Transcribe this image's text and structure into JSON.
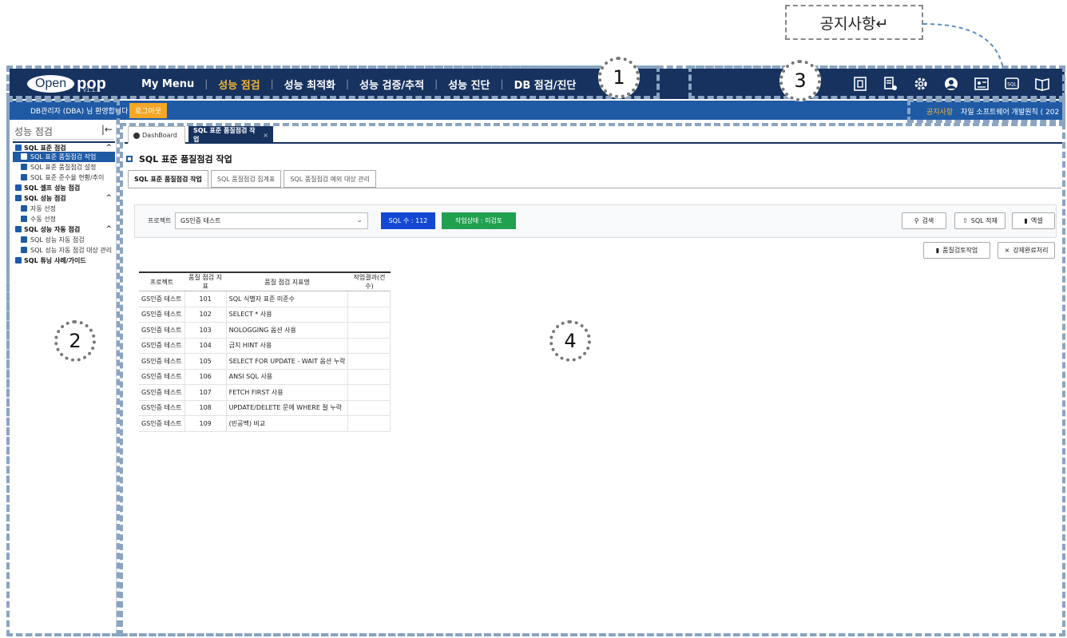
{
  "notice_annotation": "공지사항↵",
  "logo": {
    "left": "Open",
    "right": "pop",
    "version": "v1.1.1"
  },
  "main_nav": [
    {
      "label": "My Menu",
      "active": false
    },
    {
      "label": "성능 점검",
      "active": true
    },
    {
      "label": "성능 최적화",
      "active": false
    },
    {
      "label": "성능 검증/추적",
      "active": false
    },
    {
      "label": "성능 진단",
      "active": false
    },
    {
      "label": "DB 점검/진단",
      "active": false
    }
  ],
  "top_icons": [
    "report-icon",
    "document-settings-icon",
    "settings-gear-icon",
    "user-profile-icon",
    "id-card-icon",
    "sql-book-icon",
    "manual-book-icon"
  ],
  "subbar": {
    "welcome": "DB관리자 (DBA) 님 환영합니다",
    "logout": "로그아웃",
    "notice_label": "공지사항",
    "notice_text": "자일 소프트웨어 개발원칙 ( 202"
  },
  "sidebar": {
    "title": "성능 점검",
    "collapse_icon": "collapse-left-icon",
    "items": [
      {
        "label": "SQL 표준 점검",
        "level": 1,
        "expanded": true,
        "icon": "export-icon",
        "icon_color": "#1f5aa5"
      },
      {
        "label": "SQL 표준 품질점검 작업",
        "level": 2,
        "selected": true,
        "icon": "check-icon",
        "icon_color": "#1f5aa5"
      },
      {
        "label": "SQL 표준 품질점검 설정",
        "level": 2,
        "icon": "check-icon",
        "icon_color": "#1f5aa5"
      },
      {
        "label": "SQL 표준 준수율 현황/추이",
        "level": 2,
        "icon": "brush-icon",
        "icon_color": "#1f5aa5"
      },
      {
        "label": "SQL 셀프 성능 점검",
        "level": 1,
        "icon": "database-icon",
        "icon_color": "#1f5aa5"
      },
      {
        "label": "SQL 성능 점검",
        "level": 1,
        "expanded": true,
        "icon": "wand-icon",
        "icon_color": "#1f5aa5"
      },
      {
        "label": "자동 선정",
        "level": 2,
        "icon": "auto-icon",
        "icon_color": "#1f5aa5"
      },
      {
        "label": "수동 선정",
        "level": 2,
        "icon": "manual-icon",
        "icon_color": "#1f5aa5"
      },
      {
        "label": "SQL 성능 자동 점검",
        "level": 1,
        "expanded": true,
        "icon": "bug-icon",
        "icon_color": "#1f5aa5"
      },
      {
        "label": "SQL 성능 자동 점검",
        "level": 2,
        "icon": "bar-icon",
        "icon_color": "#1f5aa5"
      },
      {
        "label": "SQL 성능 자동 점검 대상 관리",
        "level": 2,
        "icon": "bar-icon",
        "icon_color": "#1f5aa5"
      },
      {
        "label": "SQL 튜닝 사례/가이드",
        "level": 1,
        "icon": "book-icon",
        "icon_color": "#1f5aa5"
      }
    ]
  },
  "content_tabs": [
    {
      "label": "DashBoard",
      "icon": "dashboard-icon"
    },
    {
      "label": "SQL 표준 품질점검 작업",
      "active": true,
      "close": "×"
    }
  ],
  "page_title": "SQL 표준 품질점검 작업",
  "sub_tabs": [
    {
      "label": "SQL 표준 품질점검 작업",
      "active": true
    },
    {
      "label": "SQL 품질점검 집계표"
    },
    {
      "label": "SQL 품질점검 예외 대상 관리"
    }
  ],
  "filter": {
    "project_label": "프로젝트",
    "project_value": "GS인증 테스트",
    "sql_count": "SQL 수 : 112",
    "status": "작업상태 : 미검토"
  },
  "buttons": {
    "search": "검색",
    "sql_load": "SQL 적재",
    "excel": "엑셀",
    "review": "품질검토작업",
    "force_complete": "강제완료처리"
  },
  "table": {
    "headers": [
      "프로젝트",
      "품질 점검 지표",
      "품질 점검 지표명",
      "작업결과(건수)"
    ],
    "rows": [
      [
        "GS인증 테스트",
        "101",
        "SQL 식별자 표준 미준수",
        ""
      ],
      [
        "GS인증 테스트",
        "102",
        "SELECT * 사용",
        ""
      ],
      [
        "GS인증 테스트",
        "103",
        "NOLOGGING 옵션 사용",
        ""
      ],
      [
        "GS인증 테스트",
        "104",
        "금지 HINT 사용",
        ""
      ],
      [
        "GS인증 테스트",
        "105",
        "SELECT FOR UPDATE - WAIT 옵션 누락",
        ""
      ],
      [
        "GS인증 테스트",
        "106",
        "ANSI SQL 사용",
        ""
      ],
      [
        "GS인증 테스트",
        "107",
        "FETCH FIRST 사용",
        ""
      ],
      [
        "GS인증 테스트",
        "108",
        "UPDATE/DELETE 문에 WHERE 절 누락",
        ""
      ],
      [
        "GS인증 테스트",
        "109",
        "(빈공백) 비교",
        ""
      ]
    ]
  },
  "markers": [
    "1",
    "2",
    "3",
    "4"
  ],
  "colors": {
    "header_bg": "#17325f",
    "subbar_bg": "#1f5aa5",
    "active_nav": "#f5b431",
    "sql_badge": "#1348d4",
    "status_badge": "#21a050",
    "logout_bg": "#f5a623"
  }
}
